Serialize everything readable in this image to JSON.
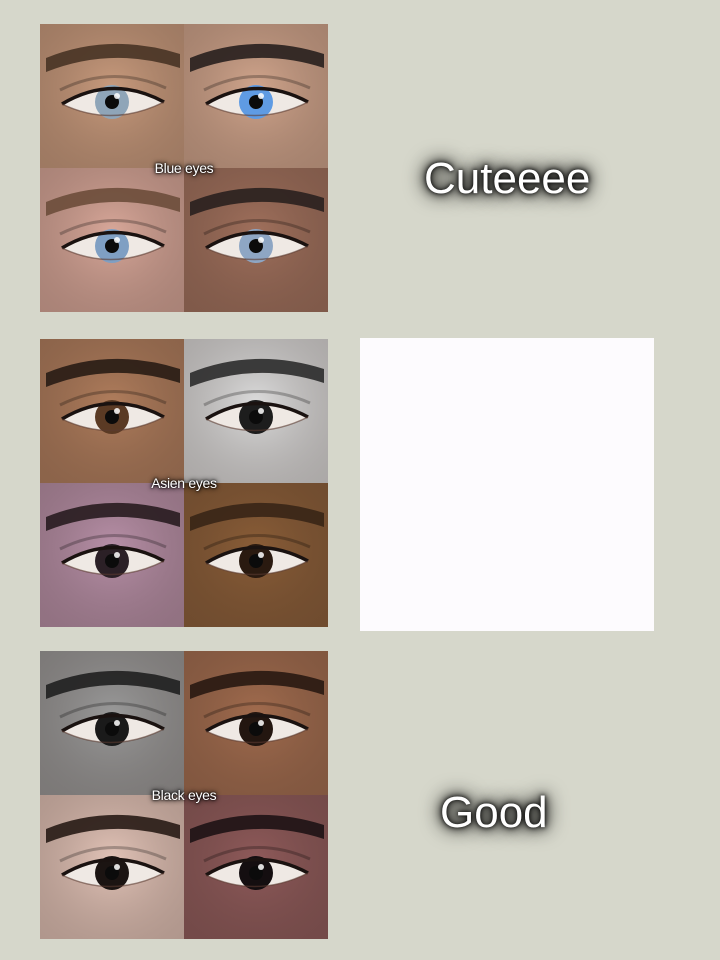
{
  "rows": [
    {
      "label": "Blue eyes",
      "verdict": "Cuteeee",
      "eyes": [
        {
          "skin": "#c99b7d",
          "iris": "#8fa5b8",
          "brow": "#4a3526"
        },
        {
          "skin": "#d2a68d",
          "iris": "#5f9be3",
          "brow": "#2a2220"
        },
        {
          "skin": "#d9a89a",
          "iris": "#7f9fc3",
          "brow": "#6e4e3c"
        },
        {
          "skin": "#a0705c",
          "iris": "#8ea6c4",
          "brow": "#2b2220"
        }
      ]
    },
    {
      "label": "Asien eyes",
      "verdict": "",
      "eyes": [
        {
          "skin": "#b07d5c",
          "iris": "#5a3a24",
          "brow": "#2a1d16"
        },
        {
          "skin": "#dcdcdc",
          "iris": "#1d1d1d",
          "brow": "#2f2f2f"
        },
        {
          "skin": "#b890a8",
          "iris": "#2b2026",
          "brow": "#2a1d22"
        },
        {
          "skin": "#8a5d37",
          "iris": "#2a1a10",
          "brow": "#3a2617"
        }
      ]
    },
    {
      "label": "Black eyes",
      "verdict": "Good",
      "eyes": [
        {
          "skin": "#9a9a9a",
          "iris": "#1a1a1a",
          "brow": "#222222"
        },
        {
          "skin": "#a26c4e",
          "iris": "#231610",
          "brow": "#2a1a12"
        },
        {
          "skin": "#e3c4b8",
          "iris": "#1b1412",
          "brow": "#2a1d18"
        },
        {
          "skin": "#8f5a5a",
          "iris": "#140e10",
          "brow": "#1f1416"
        }
      ]
    }
  ]
}
